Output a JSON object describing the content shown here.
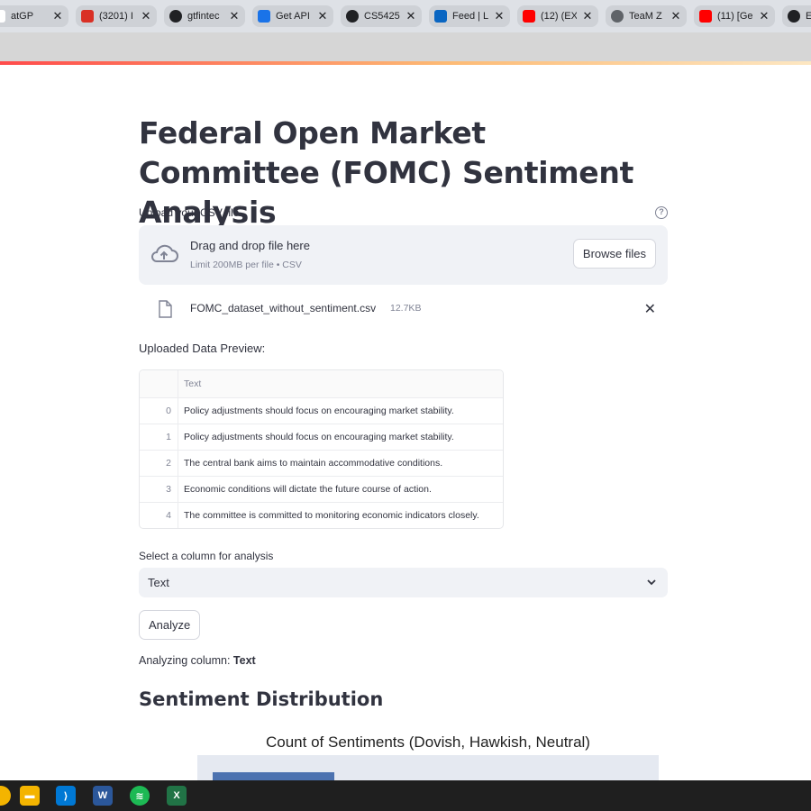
{
  "browser": {
    "tabs": [
      {
        "label": "atGP",
        "fav": "chatgpt-icon",
        "color": "#ffffff"
      },
      {
        "label": "(3201) I",
        "fav": "mail-icon",
        "color": "#d93025"
      },
      {
        "label": "gtfintec",
        "fav": "github-icon",
        "color": "#202124"
      },
      {
        "label": "Get API",
        "fav": "api-icon",
        "color": "#1a73e8"
      },
      {
        "label": "CS5425",
        "fav": "github-icon",
        "color": "#202124"
      },
      {
        "label": "Feed | L",
        "fav": "linkedin-icon",
        "color": "#0a66c2"
      },
      {
        "label": "(12) (EX",
        "fav": "youtube-icon",
        "color": "#ff0000"
      },
      {
        "label": "TeaM Z",
        "fav": "globe-icon",
        "color": "#5f6368"
      },
      {
        "label": "(11) [Ge",
        "fav": "youtube-icon",
        "color": "#ff0000"
      },
      {
        "label": "End-to",
        "fav": "github-icon",
        "color": "#202124"
      },
      {
        "label": "",
        "fav": "google-icon",
        "color": "#4285f4"
      }
    ]
  },
  "app": {
    "title": "Federal Open Market Committee (FOMC) Sentiment Analysis",
    "upload": {
      "label": "Upload your CSV file",
      "drag_text": "Drag and drop file here",
      "limit_text": "Limit 200MB per file • CSV",
      "browse_label": "Browse files"
    },
    "file": {
      "name": "FOMC_dataset_without_sentiment.csv",
      "size": "12.7KB"
    },
    "preview": {
      "label": "Uploaded Data Preview:",
      "column_header": "Text",
      "rows": [
        {
          "index": "0",
          "text": "Policy adjustments should focus on encouraging market stability."
        },
        {
          "index": "1",
          "text": "Policy adjustments should focus on encouraging market stability."
        },
        {
          "index": "2",
          "text": "The central bank aims to maintain accommodative conditions."
        },
        {
          "index": "3",
          "text": "Economic conditions will dictate the future course of action."
        },
        {
          "index": "4",
          "text": "The committee is committed to monitoring economic indicators closely."
        }
      ]
    },
    "select": {
      "label": "Select a column for analysis",
      "value": "Text"
    },
    "analyze_label": "Analyze",
    "analyzing_prefix": "Analyzing column: ",
    "analyzing_column": "Text",
    "section_title": "Sentiment Distribution",
    "chart_title": "Count of Sentiments (Dovish, Hawkish, Neutral)"
  },
  "taskbar": {
    "apps": [
      {
        "name": "file-explorer-icon",
        "color": "#f4b400"
      },
      {
        "name": "vscode-icon",
        "color": "#0078d4"
      },
      {
        "name": "word-icon",
        "color": "#2b579a"
      },
      {
        "name": "spotify-icon",
        "color": "#1db954"
      },
      {
        "name": "excel-icon",
        "color": "#217346"
      }
    ]
  }
}
